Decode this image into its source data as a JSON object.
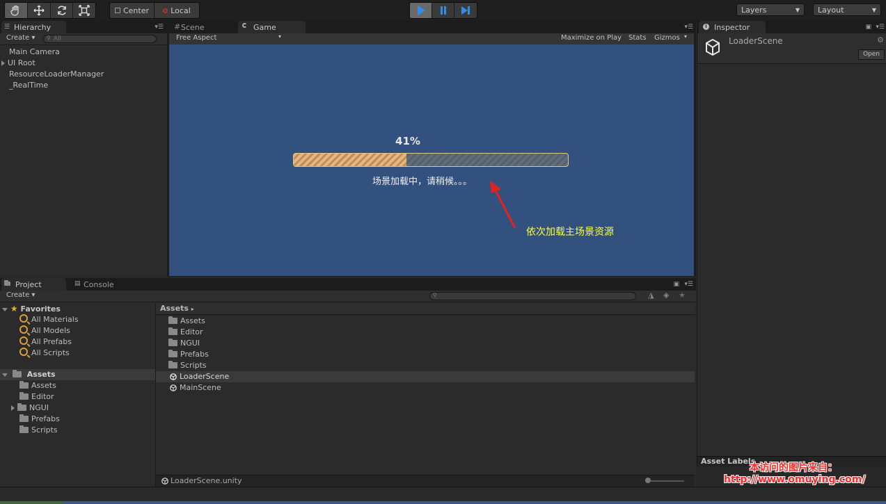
{
  "toolbar": {
    "pivot_center": "Center",
    "pivot_local": "Local",
    "layers": "Layers",
    "layout": "Layout"
  },
  "hierarchy": {
    "tab": "Hierarchy",
    "create": "Create",
    "search_placeholder": "All",
    "items": [
      {
        "label": "Main Camera",
        "expandable": false
      },
      {
        "label": "UI Root",
        "expandable": true
      },
      {
        "label": "ResourceLoaderManager",
        "expandable": false
      },
      {
        "label": "_RealTime",
        "expandable": false
      }
    ]
  },
  "scene_tabs": {
    "scene": "Scene",
    "game": "Game",
    "aspect": "Free Aspect",
    "maximize": "Maximize on Play",
    "stats": "Stats",
    "gizmos": "Gizmos"
  },
  "game": {
    "progress_text": "41%",
    "progress": 0.41,
    "loading_text": "场景加载中，请稍候。。。",
    "annotation": "依次加载主场景资源",
    "annotation_color": "#ffff33",
    "arrow_color": "#e0231e",
    "bg_color": "#33517f"
  },
  "inspector": {
    "tab": "Inspector",
    "object_name": "LoaderScene",
    "open_button": "Open",
    "asset_labels": "Asset Labels"
  },
  "project": {
    "tab_project": "Project",
    "tab_console": "Console",
    "create": "Create",
    "favorites_header": "Favorites",
    "favorites": [
      "All Materials",
      "All Models",
      "All Prefabs",
      "All Scripts"
    ],
    "assets_header": "Assets",
    "tree_assets": [
      {
        "label": "Assets",
        "expandable": false
      },
      {
        "label": "Editor",
        "expandable": false
      },
      {
        "label": "NGUI",
        "expandable": true
      },
      {
        "label": "Prefabs",
        "expandable": false
      },
      {
        "label": "Scripts",
        "expandable": false
      }
    ],
    "breadcrumb": "Assets",
    "content": [
      {
        "label": "Assets",
        "type": "folder"
      },
      {
        "label": "Editor",
        "type": "folder"
      },
      {
        "label": "NGUI",
        "type": "folder"
      },
      {
        "label": "Prefabs",
        "type": "folder"
      },
      {
        "label": "Scripts",
        "type": "folder"
      },
      {
        "label": "LoaderScene",
        "type": "scene",
        "selected": true
      },
      {
        "label": "MainScene",
        "type": "scene"
      }
    ],
    "status_file": "LoaderScene.unity"
  },
  "watermark": {
    "line1": "本访问的图片来自：",
    "line2": "http://www.omuying.com/"
  }
}
